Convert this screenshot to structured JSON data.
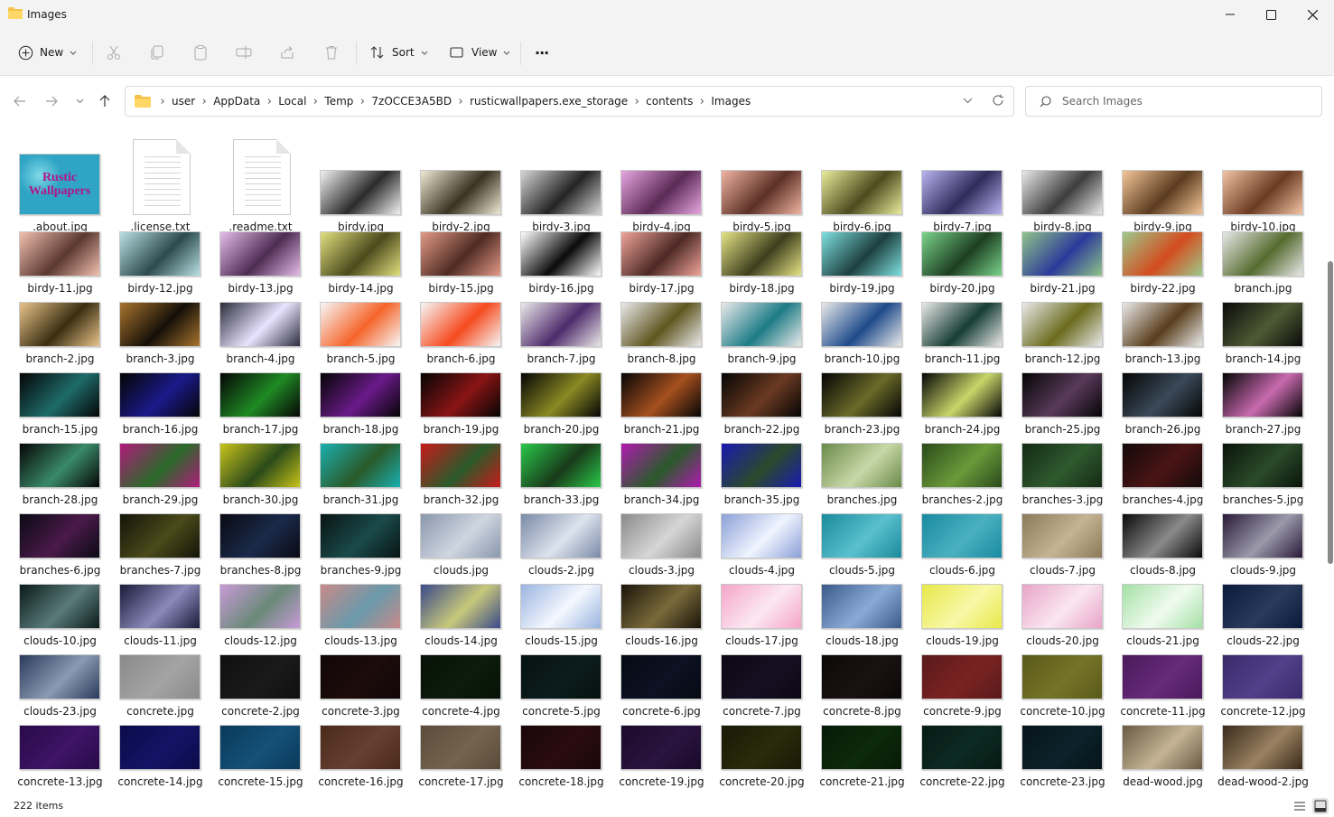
{
  "window": {
    "title": "Images"
  },
  "toolbar": {
    "new_label": "New",
    "sort_label": "Sort",
    "view_label": "View",
    "more_label": "···"
  },
  "address": {
    "crumbs": [
      "user",
      "AppData",
      "Local",
      "Temp",
      "7zOCCE3A5BD",
      "rusticwallpapers.exe_storage",
      "contents",
      "Images"
    ]
  },
  "search": {
    "placeholder": "Search Images"
  },
  "status": {
    "count": "222 items"
  },
  "files": [
    {
      "name": ".about.jpg",
      "kind": "logo",
      "colors": [
        "#2fa4c4",
        "#7fd9e8"
      ],
      "logo_text": "Rustic Wallpapers"
    },
    {
      "name": ".license.txt",
      "kind": "doc"
    },
    {
      "name": ".readme.txt",
      "kind": "doc"
    },
    {
      "name": "birdy.jpg",
      "kind": "img",
      "colors": [
        "#f2f2f2",
        "#2b2b2b"
      ]
    },
    {
      "name": "birdy-2.jpg",
      "kind": "img",
      "colors": [
        "#efe9d4",
        "#3a3222"
      ]
    },
    {
      "name": "birdy-3.jpg",
      "kind": "img",
      "colors": [
        "#d6d6d6",
        "#242424"
      ]
    },
    {
      "name": "birdy-4.jpg",
      "kind": "img",
      "colors": [
        "#e7a6e2",
        "#5b2a55"
      ]
    },
    {
      "name": "birdy-5.jpg",
      "kind": "img",
      "colors": [
        "#f0b4a2",
        "#5c3026"
      ]
    },
    {
      "name": "birdy-6.jpg",
      "kind": "img",
      "colors": [
        "#e9ed9a",
        "#4d4b1f"
      ]
    },
    {
      "name": "birdy-7.jpg",
      "kind": "img",
      "colors": [
        "#b9b4f0",
        "#2f2b5a"
      ]
    },
    {
      "name": "birdy-8.jpg",
      "kind": "img",
      "colors": [
        "#e9e9e9",
        "#3d3d3d"
      ]
    },
    {
      "name": "birdy-9.jpg",
      "kind": "img",
      "colors": [
        "#f4c79a",
        "#5b3b1f"
      ]
    },
    {
      "name": "birdy-10.jpg",
      "kind": "img",
      "colors": [
        "#f2c4a4",
        "#6b3a22"
      ]
    },
    {
      "name": "birdy-11.jpg",
      "kind": "img",
      "colors": [
        "#f3c0b1",
        "#5a3830"
      ]
    },
    {
      "name": "birdy-12.jpg",
      "kind": "img",
      "colors": [
        "#b9e0e3",
        "#2c4b4d"
      ]
    },
    {
      "name": "birdy-13.jpg",
      "kind": "img",
      "colors": [
        "#e5bde9",
        "#4d2c52"
      ]
    },
    {
      "name": "birdy-14.jpg",
      "kind": "img",
      "colors": [
        "#e1e07f",
        "#4b4a1c"
      ]
    },
    {
      "name": "birdy-15.jpg",
      "kind": "img",
      "colors": [
        "#e39a88",
        "#4f2b22"
      ]
    },
    {
      "name": "birdy-16.jpg",
      "kind": "img",
      "colors": [
        "#ffffff",
        "#0a0a0a"
      ]
    },
    {
      "name": "birdy-17.jpg",
      "kind": "img",
      "colors": [
        "#f0a49a",
        "#4d2a25"
      ]
    },
    {
      "name": "birdy-18.jpg",
      "kind": "img",
      "colors": [
        "#e4e487",
        "#3e3e1d"
      ]
    },
    {
      "name": "birdy-19.jpg",
      "kind": "img",
      "colors": [
        "#7fe0e0",
        "#1d3f3f"
      ]
    },
    {
      "name": "birdy-20.jpg",
      "kind": "img",
      "colors": [
        "#7ad48a",
        "#1d3e22"
      ]
    },
    {
      "name": "birdy-21.jpg",
      "kind": "img",
      "colors": [
        "#8fc48a",
        "#2b3a9a"
      ]
    },
    {
      "name": "birdy-22.jpg",
      "kind": "img",
      "colors": [
        "#9dc88b",
        "#d44c1f"
      ]
    },
    {
      "name": "branch.jpg",
      "kind": "img",
      "colors": [
        "#e8e8e8",
        "#556b2f"
      ]
    },
    {
      "name": "branch-2.jpg",
      "kind": "img",
      "colors": [
        "#e9c48a",
        "#3b2d12"
      ]
    },
    {
      "name": "branch-3.jpg",
      "kind": "img",
      "colors": [
        "#a8742e",
        "#151008"
      ]
    },
    {
      "name": "branch-4.jpg",
      "kind": "img",
      "colors": [
        "#2c2c3c",
        "#e8e4ff"
      ]
    },
    {
      "name": "branch-5.jpg",
      "kind": "img",
      "colors": [
        "#f7f7f7",
        "#f5642a"
      ]
    },
    {
      "name": "branch-6.jpg",
      "kind": "img",
      "colors": [
        "#f7f7f7",
        "#f54a1e"
      ]
    },
    {
      "name": "branch-7.jpg",
      "kind": "img",
      "colors": [
        "#eaeaea",
        "#4e2a6b"
      ]
    },
    {
      "name": "branch-8.jpg",
      "kind": "img",
      "colors": [
        "#eaeaea",
        "#5f5620"
      ]
    },
    {
      "name": "branch-9.jpg",
      "kind": "img",
      "colors": [
        "#eaeaea",
        "#1d7c86"
      ]
    },
    {
      "name": "branch-10.jpg",
      "kind": "img",
      "colors": [
        "#eaeaea",
        "#1e4a8a"
      ]
    },
    {
      "name": "branch-11.jpg",
      "kind": "img",
      "colors": [
        "#eaeaea",
        "#163d33"
      ]
    },
    {
      "name": "branch-12.jpg",
      "kind": "img",
      "colors": [
        "#eaeaea",
        "#6b6b1f"
      ]
    },
    {
      "name": "branch-13.jpg",
      "kind": "img",
      "colors": [
        "#eaeaea",
        "#5a3d1c"
      ]
    },
    {
      "name": "branch-14.jpg",
      "kind": "img",
      "colors": [
        "#0a0a0a",
        "#4e5a34"
      ]
    },
    {
      "name": "branch-15.jpg",
      "kind": "img",
      "colors": [
        "#050505",
        "#1f6b6b"
      ]
    },
    {
      "name": "branch-16.jpg",
      "kind": "img",
      "colors": [
        "#050505",
        "#1a1a8a"
      ]
    },
    {
      "name": "branch-17.jpg",
      "kind": "img",
      "colors": [
        "#050505",
        "#1f8a24"
      ]
    },
    {
      "name": "branch-18.jpg",
      "kind": "img",
      "colors": [
        "#050505",
        "#6a1a8a"
      ]
    },
    {
      "name": "branch-19.jpg",
      "kind": "img",
      "colors": [
        "#050505",
        "#8a1414"
      ]
    },
    {
      "name": "branch-20.jpg",
      "kind": "img",
      "colors": [
        "#050505",
        "#8a8a24"
      ]
    },
    {
      "name": "branch-21.jpg",
      "kind": "img",
      "colors": [
        "#050505",
        "#a6501f"
      ]
    },
    {
      "name": "branch-22.jpg",
      "kind": "img",
      "colors": [
        "#050505",
        "#6b3a22"
      ]
    },
    {
      "name": "branch-23.jpg",
      "kind": "img",
      "colors": [
        "#050505",
        "#6b6a2a"
      ]
    },
    {
      "name": "branch-24.jpg",
      "kind": "img",
      "colors": [
        "#050505",
        "#c8d66a"
      ]
    },
    {
      "name": "branch-25.jpg",
      "kind": "img",
      "colors": [
        "#050505",
        "#5a3a5a"
      ]
    },
    {
      "name": "branch-26.jpg",
      "kind": "img",
      "colors": [
        "#050505",
        "#3a4a5a"
      ]
    },
    {
      "name": "branch-27.jpg",
      "kind": "img",
      "colors": [
        "#050505",
        "#c86ab0"
      ]
    },
    {
      "name": "branch-28.jpg",
      "kind": "img",
      "colors": [
        "#050505",
        "#3a8a6a"
      ]
    },
    {
      "name": "branch-29.jpg",
      "kind": "img",
      "colors": [
        "#b01a7a",
        "#2a6a2a"
      ]
    },
    {
      "name": "branch-30.jpg",
      "kind": "img",
      "colors": [
        "#c8c41a",
        "#2a4a1a"
      ]
    },
    {
      "name": "branch-31.jpg",
      "kind": "img",
      "colors": [
        "#1ab0b0",
        "#2a5a2a"
      ]
    },
    {
      "name": "branch-32.jpg",
      "kind": "img",
      "colors": [
        "#c81a1a",
        "#2a5a2a"
      ]
    },
    {
      "name": "branch-33.jpg",
      "kind": "img",
      "colors": [
        "#2ac84a",
        "#1a3a1a"
      ]
    },
    {
      "name": "branch-34.jpg",
      "kind": "img",
      "colors": [
        "#b01ab0",
        "#2a5a2a"
      ]
    },
    {
      "name": "branch-35.jpg",
      "kind": "img",
      "colors": [
        "#1a1ab0",
        "#2a4a2a"
      ]
    },
    {
      "name": "branches.jpg",
      "kind": "img",
      "colors": [
        "#6a8a4a",
        "#c8d8a8"
      ]
    },
    {
      "name": "branches-2.jpg",
      "kind": "img",
      "colors": [
        "#2a4a1a",
        "#6a9a3a"
      ]
    },
    {
      "name": "branches-3.jpg",
      "kind": "img",
      "colors": [
        "#142a14",
        "#2f5a2f"
      ]
    },
    {
      "name": "branches-4.jpg",
      "kind": "img",
      "colors": [
        "#140a0a",
        "#4a1414"
      ]
    },
    {
      "name": "branches-5.jpg",
      "kind": "img",
      "colors": [
        "#0a140a",
        "#2a4a2a"
      ]
    },
    {
      "name": "branches-6.jpg",
      "kind": "img",
      "colors": [
        "#0a0a14",
        "#4a1a4a"
      ]
    },
    {
      "name": "branches-7.jpg",
      "kind": "img",
      "colors": [
        "#14140a",
        "#4a4a1a"
      ]
    },
    {
      "name": "branches-8.jpg",
      "kind": "img",
      "colors": [
        "#0a0a14",
        "#1a2a4a"
      ]
    },
    {
      "name": "branches-9.jpg",
      "kind": "img",
      "colors": [
        "#0a1414",
        "#1a4a4a"
      ]
    },
    {
      "name": "clouds.jpg",
      "kind": "img",
      "colors": [
        "#8a97ad",
        "#cfd6e0"
      ]
    },
    {
      "name": "clouds-2.jpg",
      "kind": "img",
      "colors": [
        "#7a8aa6",
        "#dde3ee"
      ]
    },
    {
      "name": "clouds-3.jpg",
      "kind": "img",
      "colors": [
        "#8a8a8a",
        "#d6d6d6"
      ]
    },
    {
      "name": "clouds-4.jpg",
      "kind": "img",
      "colors": [
        "#8aa0d6",
        "#f0f4ff"
      ]
    },
    {
      "name": "clouds-5.jpg",
      "kind": "img",
      "colors": [
        "#1a8a9a",
        "#5ac0cf"
      ]
    },
    {
      "name": "clouds-6.jpg",
      "kind": "img",
      "colors": [
        "#1a8aa0",
        "#4ab0c0"
      ]
    },
    {
      "name": "clouds-7.jpg",
      "kind": "img",
      "colors": [
        "#8a7a5a",
        "#c4b494"
      ]
    },
    {
      "name": "clouds-8.jpg",
      "kind": "img",
      "colors": [
        "#0a0a0a",
        "#8a8a8a"
      ]
    },
    {
      "name": "clouds-9.jpg",
      "kind": "img",
      "colors": [
        "#2a1a3a",
        "#9a9aaa"
      ]
    },
    {
      "name": "clouds-10.jpg",
      "kind": "img",
      "colors": [
        "#0a1a1a",
        "#5a7a7a"
      ]
    },
    {
      "name": "clouds-11.jpg",
      "kind": "img",
      "colors": [
        "#1a1a3a",
        "#8a8aba"
      ]
    },
    {
      "name": "clouds-12.jpg",
      "kind": "img",
      "colors": [
        "#c89ad6",
        "#6a8a7a"
      ]
    },
    {
      "name": "clouds-13.jpg",
      "kind": "img",
      "colors": [
        "#c88a8a",
        "#6a9aaa"
      ]
    },
    {
      "name": "clouds-14.jpg",
      "kind": "img",
      "colors": [
        "#3a4a8a",
        "#c8c87a"
      ]
    },
    {
      "name": "clouds-15.jpg",
      "kind": "img",
      "colors": [
        "#9ab4e0",
        "#f4f8ff"
      ]
    },
    {
      "name": "clouds-16.jpg",
      "kind": "img",
      "colors": [
        "#1a140a",
        "#7a6a3a"
      ]
    },
    {
      "name": "clouds-17.jpg",
      "kind": "img",
      "colors": [
        "#f4a4c8",
        "#fce8f2"
      ]
    },
    {
      "name": "clouds-18.jpg",
      "kind": "img",
      "colors": [
        "#3a5a8a",
        "#8aaad6"
      ]
    },
    {
      "name": "clouds-19.jpg",
      "kind": "img",
      "colors": [
        "#e8e84a",
        "#f8f8a8"
      ]
    },
    {
      "name": "clouds-20.jpg",
      "kind": "img",
      "colors": [
        "#e8a4c8",
        "#fae6f0"
      ]
    },
    {
      "name": "clouds-21.jpg",
      "kind": "img",
      "colors": [
        "#a4e0a4",
        "#f0fbf0"
      ]
    },
    {
      "name": "clouds-22.jpg",
      "kind": "img",
      "colors": [
        "#0a1a3a",
        "#2a3a5a"
      ]
    },
    {
      "name": "clouds-23.jpg",
      "kind": "img",
      "colors": [
        "#2a3a5a",
        "#8a9ab4"
      ]
    },
    {
      "name": "concrete.jpg",
      "kind": "img",
      "colors": [
        "#8a8a8a",
        "#a4a4a4"
      ]
    },
    {
      "name": "concrete-2.jpg",
      "kind": "img",
      "colors": [
        "#0f0f0f",
        "#1a1a1a"
      ]
    },
    {
      "name": "concrete-3.jpg",
      "kind": "img",
      "colors": [
        "#120606",
        "#1c0c0c"
      ]
    },
    {
      "name": "concrete-4.jpg",
      "kind": "img",
      "colors": [
        "#061206",
        "#0c1c0c"
      ]
    },
    {
      "name": "concrete-5.jpg",
      "kind": "img",
      "colors": [
        "#061212",
        "#0c1c1c"
      ]
    },
    {
      "name": "concrete-6.jpg",
      "kind": "img",
      "colors": [
        "#060a14",
        "#0c1222"
      ]
    },
    {
      "name": "concrete-7.jpg",
      "kind": "img",
      "colors": [
        "#0c0814",
        "#160f22"
      ]
    },
    {
      "name": "concrete-8.jpg",
      "kind": "img",
      "colors": [
        "#0c0808",
        "#1a1212"
      ]
    },
    {
      "name": "concrete-9.jpg",
      "kind": "img",
      "colors": [
        "#5a1a1a",
        "#7a2222"
      ]
    },
    {
      "name": "concrete-10.jpg",
      "kind": "img",
      "colors": [
        "#5a5a1a",
        "#747428"
      ]
    },
    {
      "name": "concrete-11.jpg",
      "kind": "img",
      "colors": [
        "#4a1a5a",
        "#662a7a"
      ]
    },
    {
      "name": "concrete-12.jpg",
      "kind": "img",
      "colors": [
        "#3a2a6a",
        "#52408a"
      ]
    },
    {
      "name": "concrete-13.jpg",
      "kind": "img",
      "colors": [
        "#2a0a4a",
        "#3e1466"
      ]
    },
    {
      "name": "concrete-14.jpg",
      "kind": "img",
      "colors": [
        "#0a0a4a",
        "#141466"
      ]
    },
    {
      "name": "concrete-15.jpg",
      "kind": "img",
      "colors": [
        "#0a3a5a",
        "#145078"
      ]
    },
    {
      "name": "concrete-16.jpg",
      "kind": "img",
      "colors": [
        "#4a2a1a",
        "#664032"
      ]
    },
    {
      "name": "concrete-17.jpg",
      "kind": "img",
      "colors": [
        "#5a4a3a",
        "#74644e"
      ]
    },
    {
      "name": "concrete-18.jpg",
      "kind": "img",
      "colors": [
        "#1a0608",
        "#2a0c10"
      ]
    },
    {
      "name": "concrete-19.jpg",
      "kind": "img",
      "colors": [
        "#1a0a2a",
        "#2a1440"
      ]
    },
    {
      "name": "concrete-20.jpg",
      "kind": "img",
      "colors": [
        "#1a1a06",
        "#2a2a0c"
      ]
    },
    {
      "name": "concrete-21.jpg",
      "kind": "img",
      "colors": [
        "#061a06",
        "#0c2a0c"
      ]
    },
    {
      "name": "concrete-22.jpg",
      "kind": "img",
      "colors": [
        "#061a14",
        "#0c2a22"
      ]
    },
    {
      "name": "concrete-23.jpg",
      "kind": "img",
      "colors": [
        "#06141a",
        "#0c222a"
      ]
    },
    {
      "name": "dead-wood.jpg",
      "kind": "img",
      "colors": [
        "#6a5a44",
        "#c4b494"
      ]
    },
    {
      "name": "dead-wood-2.jpg",
      "kind": "img",
      "colors": [
        "#3a2a1a",
        "#9a8262"
      ]
    }
  ]
}
